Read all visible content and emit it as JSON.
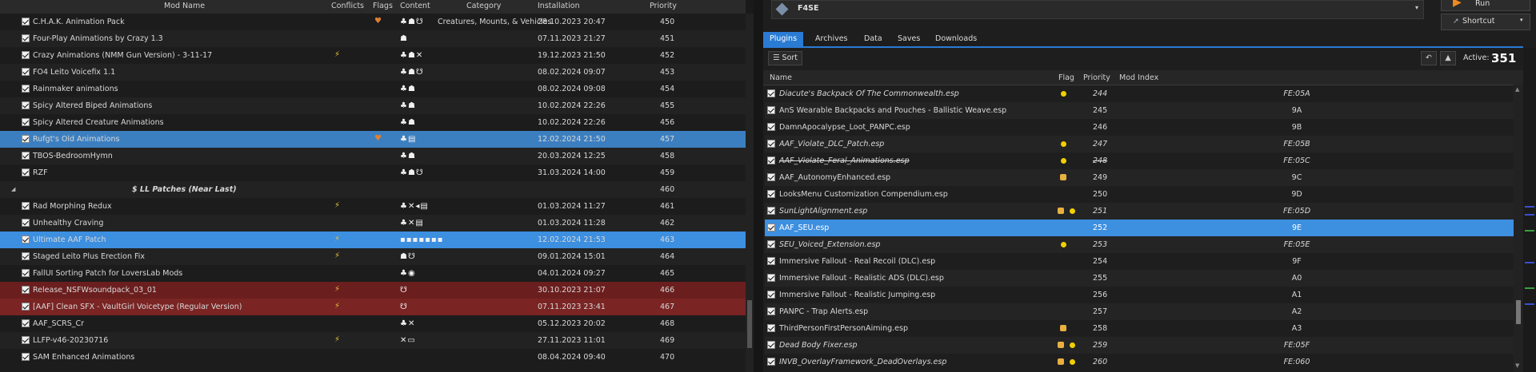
{
  "left_panel": {
    "headers": {
      "mod_name": "Mod Name",
      "conflicts": "Conflicts",
      "flags": "Flags",
      "content": "Content",
      "category": "Category",
      "installation": "Installation",
      "priority": "Priority"
    },
    "rows": [
      {
        "name": "C.H.A.K. Animation Pack",
        "flag": true,
        "content": "♣☗☋",
        "category": "Creatures, Mounts, & Vehicles",
        "installation": "28.10.2023 20:47",
        "priority": "450",
        "style": "even"
      },
      {
        "name": "Four-Play Animations by Crazy 1.3",
        "content": "☗",
        "installation": "07.11.2023 21:27",
        "priority": "451",
        "style": "odd"
      },
      {
        "name": "Crazy Animations (NMM Gun Version) - 3-11-17",
        "conflict": true,
        "content": "♣☗✕",
        "installation": "19.12.2023 21:50",
        "priority": "452",
        "style": "even"
      },
      {
        "name": "FO4 Leito Voicefix 1.1",
        "content": "♣☗☋",
        "installation": "08.02.2024 09:07",
        "priority": "453",
        "style": "odd"
      },
      {
        "name": "Rainmaker animations",
        "content": "♣☗",
        "installation": "08.02.2024 09:08",
        "priority": "454",
        "style": "even"
      },
      {
        "name": "Spicy Altered Biped Animations",
        "content": "♣☗",
        "installation": "10.02.2024 22:26",
        "priority": "455",
        "style": "odd"
      },
      {
        "name": "Spicy Altered Creature Animations",
        "content": "♣☗",
        "installation": "10.02.2024 22:26",
        "priority": "456",
        "style": "even"
      },
      {
        "name": "Rufgt's Old Animations",
        "flag": true,
        "content": "♣▤",
        "installation": "12.02.2024 21:50",
        "priority": "457",
        "style": "sel"
      },
      {
        "name": "TBOS-BedroomHymn",
        "content": "♣☗",
        "installation": "20.03.2024 12:25",
        "priority": "458",
        "style": "odd"
      },
      {
        "name": "RZF",
        "content": "♣☗☋",
        "installation": "31.03.2024 14:00",
        "priority": "459",
        "style": "even"
      },
      {
        "separator": true,
        "name": "$ LL Patches (Near Last)",
        "priority": "460",
        "style": "odd"
      },
      {
        "name": "Rad Morphing Redux",
        "conflict": true,
        "content": "♣✕◂▤",
        "installation": "01.03.2024 11:27",
        "priority": "461",
        "style": "even"
      },
      {
        "name": "Unhealthy Craving",
        "content": "♣✕▤",
        "installation": "01.03.2024 11:28",
        "priority": "462",
        "style": "odd"
      },
      {
        "name": "Ultimate AAF Patch",
        "conflict": true,
        "content": "▪▪▪▪▪▪▪",
        "installation": "12.02.2024 21:53",
        "priority": "463",
        "style": "selfocus"
      },
      {
        "name": "Staged Leito Plus Erection Fix",
        "conflict": true,
        "content": "☗☋",
        "installation": "09.01.2024 15:01",
        "priority": "464",
        "style": "odd"
      },
      {
        "name": "FallUI Sorting Patch for LoversLab Mods",
        "content": "♣◉",
        "installation": "04.01.2024 09:27",
        "priority": "465",
        "style": "even"
      },
      {
        "name": "Release_NSFWsoundpack_03_01",
        "conflict": true,
        "content": "☋",
        "installation": "30.10.2023 21:07",
        "priority": "466",
        "style": "red"
      },
      {
        "name": "[AAF] Clean SFX - VaultGirl Voicetype (Regular Version)",
        "conflict": true,
        "content": "☋",
        "installation": "07.11.2023 23:41",
        "priority": "467",
        "style": "red odd"
      },
      {
        "name": "AAF_SCRS_Cr",
        "content": "♣✕",
        "installation": "05.12.2023 20:02",
        "priority": "468",
        "style": "even"
      },
      {
        "name": "LLFP-v46-20230716",
        "conflict": true,
        "content": "✕▭",
        "installation": "27.11.2023 11:01",
        "priority": "469",
        "style": "odd"
      },
      {
        "name": "SAM Enhanced Animations",
        "content": "",
        "installation": "08.04.2024 09:40",
        "priority": "470",
        "style": "even"
      }
    ]
  },
  "right_panel": {
    "executable": "F4SE",
    "run_label": "Run",
    "shortcut_label": "Shortcut",
    "tabs": [
      "Plugins",
      "Archives",
      "Data",
      "Saves",
      "Downloads"
    ],
    "sort_label": "Sort",
    "active_label": "Active:",
    "active_value": "351",
    "headers": {
      "name": "Name",
      "flag": "Flag",
      "priority": "Priority",
      "mod_index": "Mod Index"
    },
    "rows": [
      {
        "name": "Diacute's Backpack Of The Commonwealth.esp",
        "style": "it",
        "dot": true,
        "priority": "244",
        "index": "FE:05A",
        "bg": "even"
      },
      {
        "name": "AnS Wearable Backpacks and Pouches - Ballistic Weave.esp",
        "priority": "245",
        "index": "9A",
        "bg": "odd"
      },
      {
        "name": "DamnApocalypse_Loot_PANPC.esp",
        "priority": "246",
        "index": "9B",
        "bg": "even"
      },
      {
        "name": "AAF_Violate_DLC_Patch.esp",
        "style": "it",
        "dot": true,
        "priority": "247",
        "index": "FE:05B",
        "bg": "odd"
      },
      {
        "name": "AAF_Violate_Feral_Animations.esp",
        "style": "strike",
        "dot": true,
        "priority": "248",
        "index": "FE:05C",
        "bg": "even",
        "strike": true
      },
      {
        "name": "AAF_AutonomyEnhanced.esp",
        "cube": true,
        "priority": "249",
        "index": "9C",
        "bg": "odd"
      },
      {
        "name": "LooksMenu Customization Compendium.esp",
        "priority": "250",
        "index": "9D",
        "bg": "even"
      },
      {
        "name": "SunLightAlignment.esp",
        "style": "it",
        "cube": true,
        "dot": true,
        "priority": "251",
        "index": "FE:05D",
        "bg": "odd"
      },
      {
        "name": "AAF_SEU.esp",
        "priority": "252",
        "index": "9E",
        "bg": "sel"
      },
      {
        "name": "SEU_Voiced_Extension.esp",
        "style": "it",
        "dot": true,
        "priority": "253",
        "index": "FE:05E",
        "bg": "odd"
      },
      {
        "name": "Immersive Fallout - Real Recoil (DLC).esp",
        "priority": "254",
        "index": "9F",
        "bg": "even"
      },
      {
        "name": "Immersive Fallout - Realistic ADS (DLC).esp",
        "priority": "255",
        "index": "A0",
        "bg": "odd"
      },
      {
        "name": "Immersive Fallout - Realistic Jumping.esp",
        "priority": "256",
        "index": "A1",
        "bg": "even"
      },
      {
        "name": "PANPC - Trap Alerts.esp",
        "priority": "257",
        "index": "A2",
        "bg": "odd"
      },
      {
        "name": "ThirdPersonFirstPersonAiming.esp",
        "cube": true,
        "priority": "258",
        "index": "A3",
        "bg": "even"
      },
      {
        "name": "Dead Body Fixer.esp",
        "style": "it",
        "cube": true,
        "dot": true,
        "priority": "259",
        "index": "FE:05F",
        "bg": "odd"
      },
      {
        "name": "INVB_OverlayFramework_DeadOverlays.esp",
        "style": "it",
        "cube": true,
        "dot": true,
        "priority": "260",
        "index": "FE:060",
        "bg": "even"
      }
    ]
  },
  "colors": {
    "accent": "#3d8fe0",
    "selected_row": "#3c7fc0",
    "conflict_row": "#6b1e1e",
    "flag_dot": "#f0d000"
  }
}
